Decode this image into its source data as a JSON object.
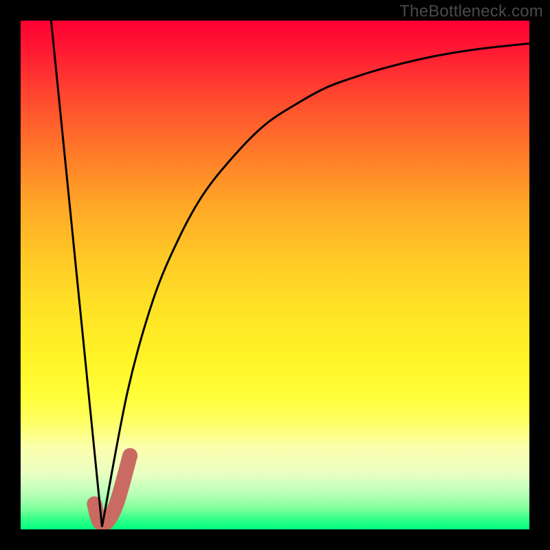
{
  "watermark": "TheBottleneck.com",
  "chart_data": {
    "type": "line",
    "title": "",
    "xlabel": "",
    "ylabel": "",
    "xlim": [
      0,
      1
    ],
    "ylim": [
      0,
      1
    ],
    "series": [
      {
        "name": "left-branch",
        "x": [
          0.06,
          0.16
        ],
        "y": [
          1.0,
          0.005
        ]
      },
      {
        "name": "right-branch-curve",
        "x": [
          0.16,
          0.21,
          0.26,
          0.31,
          0.36,
          0.42,
          0.48,
          0.54,
          0.6,
          0.66,
          0.72,
          0.78,
          0.84,
          0.9,
          0.96,
          1.0
        ],
        "y": [
          0.005,
          0.27,
          0.45,
          0.57,
          0.66,
          0.735,
          0.795,
          0.835,
          0.868,
          0.89,
          0.908,
          0.923,
          0.935,
          0.944,
          0.951,
          0.955
        ]
      },
      {
        "name": "red-hook",
        "x": [
          0.145,
          0.155,
          0.17,
          0.19,
          0.215
        ],
        "y": [
          0.05,
          0.015,
          0.015,
          0.055,
          0.145
        ],
        "stroke": "#c96b62",
        "width": 22
      }
    ]
  }
}
